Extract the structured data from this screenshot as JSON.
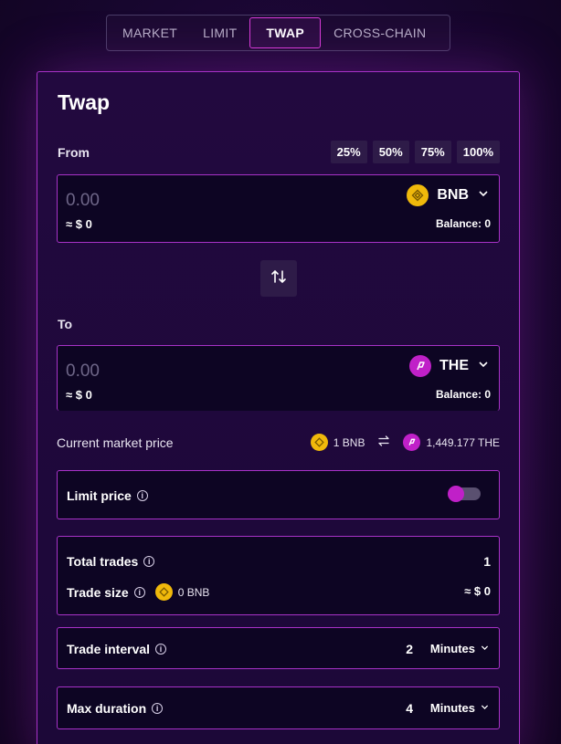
{
  "tabs": [
    {
      "label": "MARKET"
    },
    {
      "label": "LIMIT"
    },
    {
      "label": "TWAP"
    },
    {
      "label": "CROSS-CHAIN"
    }
  ],
  "panel": {
    "title": "Twap",
    "from": {
      "label": "From",
      "percent_buttons": [
        "25%",
        "50%",
        "75%",
        "100%"
      ],
      "amount_placeholder": "0.00",
      "usd_value": "≈ $ 0",
      "token": "BNB",
      "token_icon": "bnb-coin-icon",
      "balance": "Balance: 0"
    },
    "swap_icon": "swap-arrows-icon",
    "to": {
      "label": "To",
      "amount_placeholder": "0.00",
      "usd_value": "≈ $ 0",
      "token": "THE",
      "token_icon": "the-coin-icon",
      "balance": "Balance: 0"
    },
    "market_price": {
      "label": "Current market price",
      "base": "1 BNB",
      "quote": "1,449.177 THE"
    },
    "limit_price": {
      "label": "Limit price",
      "enabled": false
    },
    "total_trades": {
      "label": "Total trades",
      "value": "1"
    },
    "trade_size": {
      "label": "Trade size",
      "amount": "0 BNB",
      "usd": "≈ $ 0"
    },
    "trade_interval": {
      "label": "Trade interval",
      "value": "2",
      "unit": "Minutes"
    },
    "max_duration": {
      "label": "Max duration",
      "value": "4",
      "unit": "Minutes"
    }
  },
  "colors": {
    "accent": "#c020c8",
    "border": "#a832c8",
    "bnb": "#f0b90b",
    "background": "#180630"
  }
}
